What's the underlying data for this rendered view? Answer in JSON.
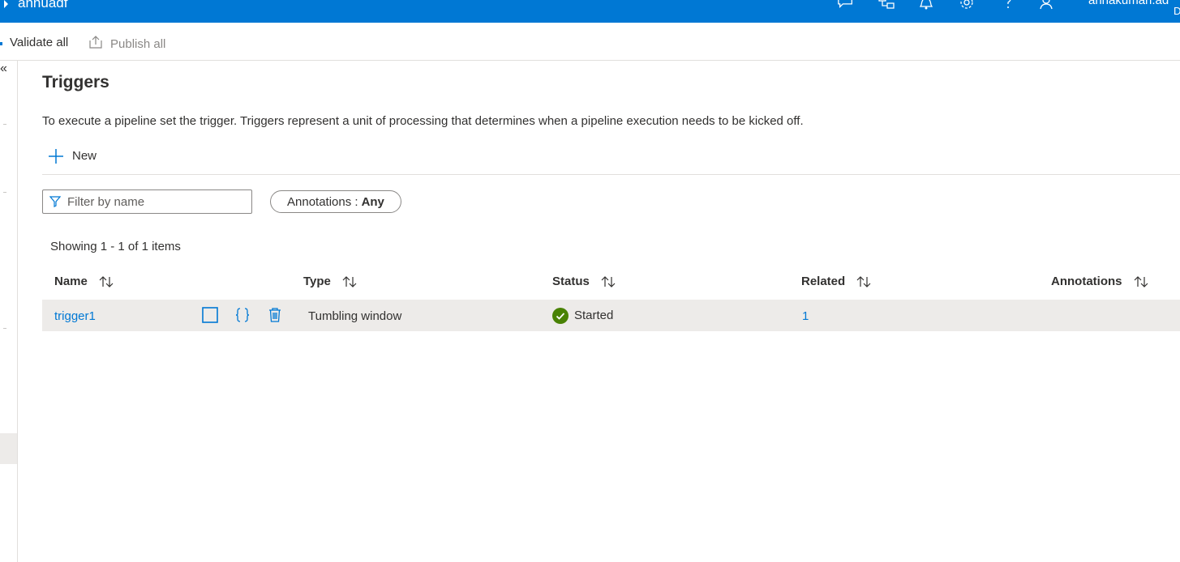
{
  "topbar": {
    "factory_name": "annuadf",
    "user_name": "annakumari.ad",
    "user_sub": "D",
    "icons": [
      "feedback-icon",
      "switch-directory-icon",
      "notifications-icon",
      "settings-icon",
      "help-icon",
      "account-icon"
    ],
    "background_color": "#0078d4"
  },
  "toolbar": {
    "validate_label": "Validate all",
    "publish_label": "Publish all"
  },
  "leftrail": {
    "collapse_glyph": "«"
  },
  "page": {
    "title": "Triggers",
    "description": "To execute a pipeline set the trigger. Triggers represent a unit of processing that determines when a pipeline execution needs to be kicked off.",
    "new_label": "New"
  },
  "filter": {
    "placeholder": "Filter by name",
    "value": ""
  },
  "annotations_filter": {
    "label": "Annotations :",
    "value": "Any"
  },
  "results": {
    "showing": "Showing 1 - 1 of 1 items"
  },
  "table": {
    "columns": [
      "Name",
      "Type",
      "Status",
      "Related",
      "Annotations"
    ],
    "rows": [
      {
        "name": "trigger1",
        "type": "Tumbling window",
        "status": "Started",
        "related": "1",
        "annotations": ""
      }
    ]
  },
  "colors": {
    "accent": "#0078d4",
    "status_started": "#498205",
    "row_selected": "#edebe9"
  }
}
